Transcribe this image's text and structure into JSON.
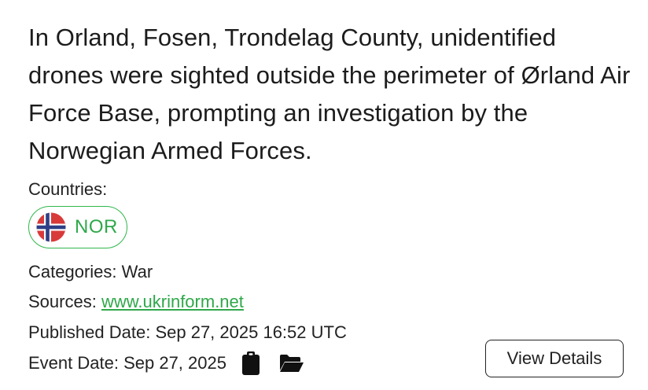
{
  "event": {
    "headline": "In Orland, Fosen, Trondelag County, unidentified drones were sighted outside the perimeter of Ørland Air Force Base, prompting an investigation by the Norwegian Armed Forces.",
    "countries_label": "Countries:",
    "countries": [
      {
        "code": "NOR",
        "flag_icon": "norway-flag-icon"
      }
    ],
    "categories_label": "Categories:",
    "categories_value": "War",
    "sources_label": "Sources:",
    "sources_value": "www.ukrinform.net",
    "published_label": "Published Date:",
    "published_value": "Sep 27, 2025 16:52 UTC",
    "event_date_label": "Event Date:",
    "event_date_value": "Sep 27, 2025",
    "view_details_label": "View Details"
  },
  "icons": {
    "copy": "clipboard-icon",
    "folder": "folder-open-icon"
  },
  "colors": {
    "accent_green": "#2fa84a",
    "chip_border": "#2fb84a",
    "text": "#1c1c1c"
  }
}
